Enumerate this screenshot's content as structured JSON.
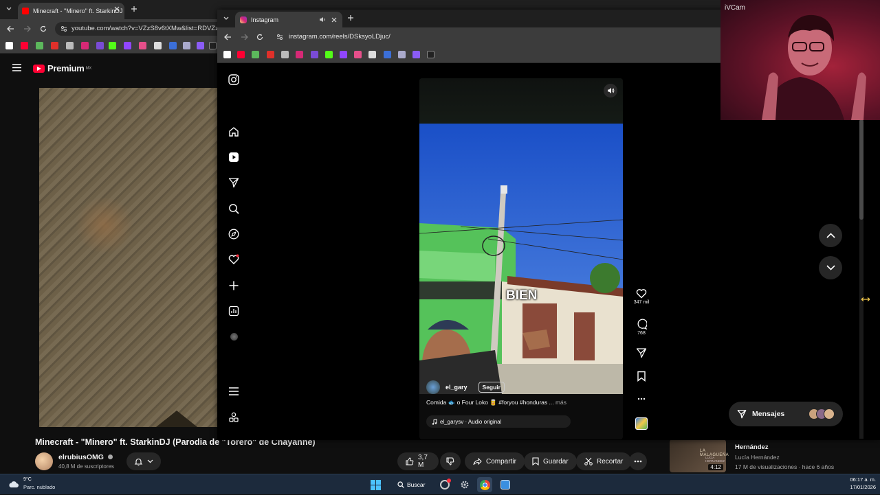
{
  "youtube": {
    "tab_title": "Minecraft - \"Minero\" ft. StarkinDJ",
    "url": "youtube.com/watch?v=VZzS8v6tXMw&list=RDVZzS",
    "logo_text": "Premium",
    "region": "MX",
    "video_title": "Minecraft - \"Minero\" ft. StarkinDJ (Parodia de \"Torero\" de Chayanne)",
    "channel_name": "elrubiusOMG",
    "subscribers": "40,8 M de suscriptores",
    "like_count": "3,7 M",
    "share_label": "Compartir",
    "save_label": "Guardar",
    "clip_label": "Recortar",
    "related": {
      "thumb_text": "LA MALAGUEÑA",
      "thumb_sub": "LUCIA HERNANDEZ",
      "duration": "4:12",
      "title": "Hernández",
      "channel": "Lucía Hernández",
      "meta": "17 M de visualizaciones · hace 6 años"
    }
  },
  "instagram": {
    "tab_title": "Instagram",
    "url": "instagram.com/reels/DSksyoLDjuc/",
    "reel": {
      "overlay_text": "BIEN",
      "username": "el_gary",
      "follow_label": "Seguir",
      "caption": "Comida 🐟 o Four Loko 🥫 #foryou #honduras ...",
      "more_label": "más",
      "audio": "el_garysv · Audio original",
      "likes": "347 mil",
      "comments": "768"
    },
    "messages_label": "Mensajes"
  },
  "webcam": {
    "label": "iVCam"
  },
  "taskbar": {
    "temp": "9°C",
    "weather": "Parc. nublado",
    "search_label": "Buscar",
    "time": "06:17 a. m.",
    "date": "17/01/2026"
  },
  "colors": {
    "youtube_red": "#ff0033",
    "instagram_gradient": [
      "#feda75",
      "#d62976",
      "#962fbf"
    ],
    "taskbar": "#1c2a3c",
    "webcam_tint": "#a3223a"
  }
}
